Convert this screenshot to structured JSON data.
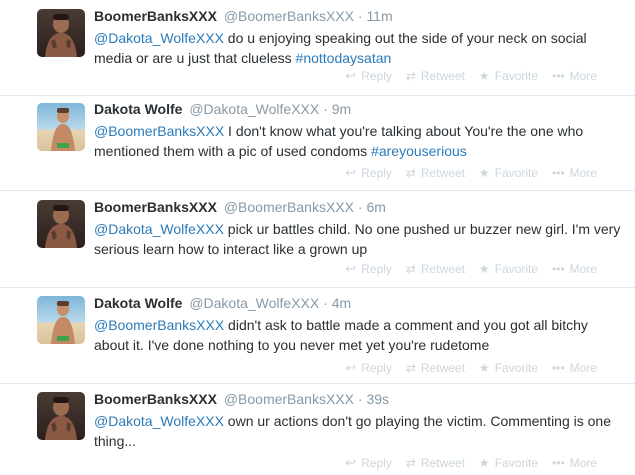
{
  "tweets": [
    {
      "name": "BoomerBanksXXX",
      "handle": "@BoomerBanksXXX",
      "sep": "·",
      "time": "11m",
      "parts": [
        {
          "t": "mention",
          "v": "@Dakota_WolfeXXX"
        },
        {
          "t": "text",
          "v": " do u enjoying speaking out the side of your neck on social media or are u just that clueless "
        },
        {
          "t": "hashtag",
          "v": "#nottodaysatan"
        }
      ],
      "avatar": "boomer"
    },
    {
      "name": "Dakota Wolfe",
      "handle": "@Dakota_WolfeXXX",
      "sep": "·",
      "time": "9m",
      "parts": [
        {
          "t": "mention",
          "v": "@BoomerBanksXXX"
        },
        {
          "t": "text",
          "v": " I don't know what you're talking about You're the one who mentioned them with a pic of used condoms "
        },
        {
          "t": "hashtag",
          "v": "#areyouserious"
        }
      ],
      "avatar": "dakota"
    },
    {
      "name": "BoomerBanksXXX",
      "handle": "@BoomerBanksXXX",
      "sep": "·",
      "time": "6m",
      "parts": [
        {
          "t": "mention",
          "v": "@Dakota_WolfeXXX"
        },
        {
          "t": "text",
          "v": " pick ur battles child. No one pushed ur buzzer new girl. I'm very serious learn how to interact like a grown up"
        }
      ],
      "avatar": "boomer"
    },
    {
      "name": "Dakota Wolfe",
      "handle": "@Dakota_WolfeXXX",
      "sep": "·",
      "time": "4m",
      "parts": [
        {
          "t": "mention",
          "v": "@BoomerBanksXXX"
        },
        {
          "t": "text",
          "v": " didn't ask to battle made a comment and you got all bitchy about it. I've done nothing to you never met yet you're rudetome"
        }
      ],
      "avatar": "dakota"
    },
    {
      "name": "BoomerBanksXXX",
      "handle": "@BoomerBanksXXX",
      "sep": "·",
      "time": "39s",
      "parts": [
        {
          "t": "mention",
          "v": "@Dakota_WolfeXXX"
        },
        {
          "t": "text",
          "v": " own ur actions don't go playing the victim. Commenting is one thing..."
        }
      ],
      "avatar": "boomer"
    }
  ],
  "actions": {
    "reply": "Reply",
    "retweet": "Retweet",
    "favorite": "Favorite",
    "more": "More"
  },
  "icons": {
    "reply": "reply-icon",
    "retweet": "retweet-icon",
    "favorite": "star-icon",
    "more": "more-dots-icon"
  },
  "colors": {
    "link": "#2b7bb9",
    "muted": "#8899a6",
    "action": "#ccd6dd",
    "divider": "#e1e8ed"
  }
}
